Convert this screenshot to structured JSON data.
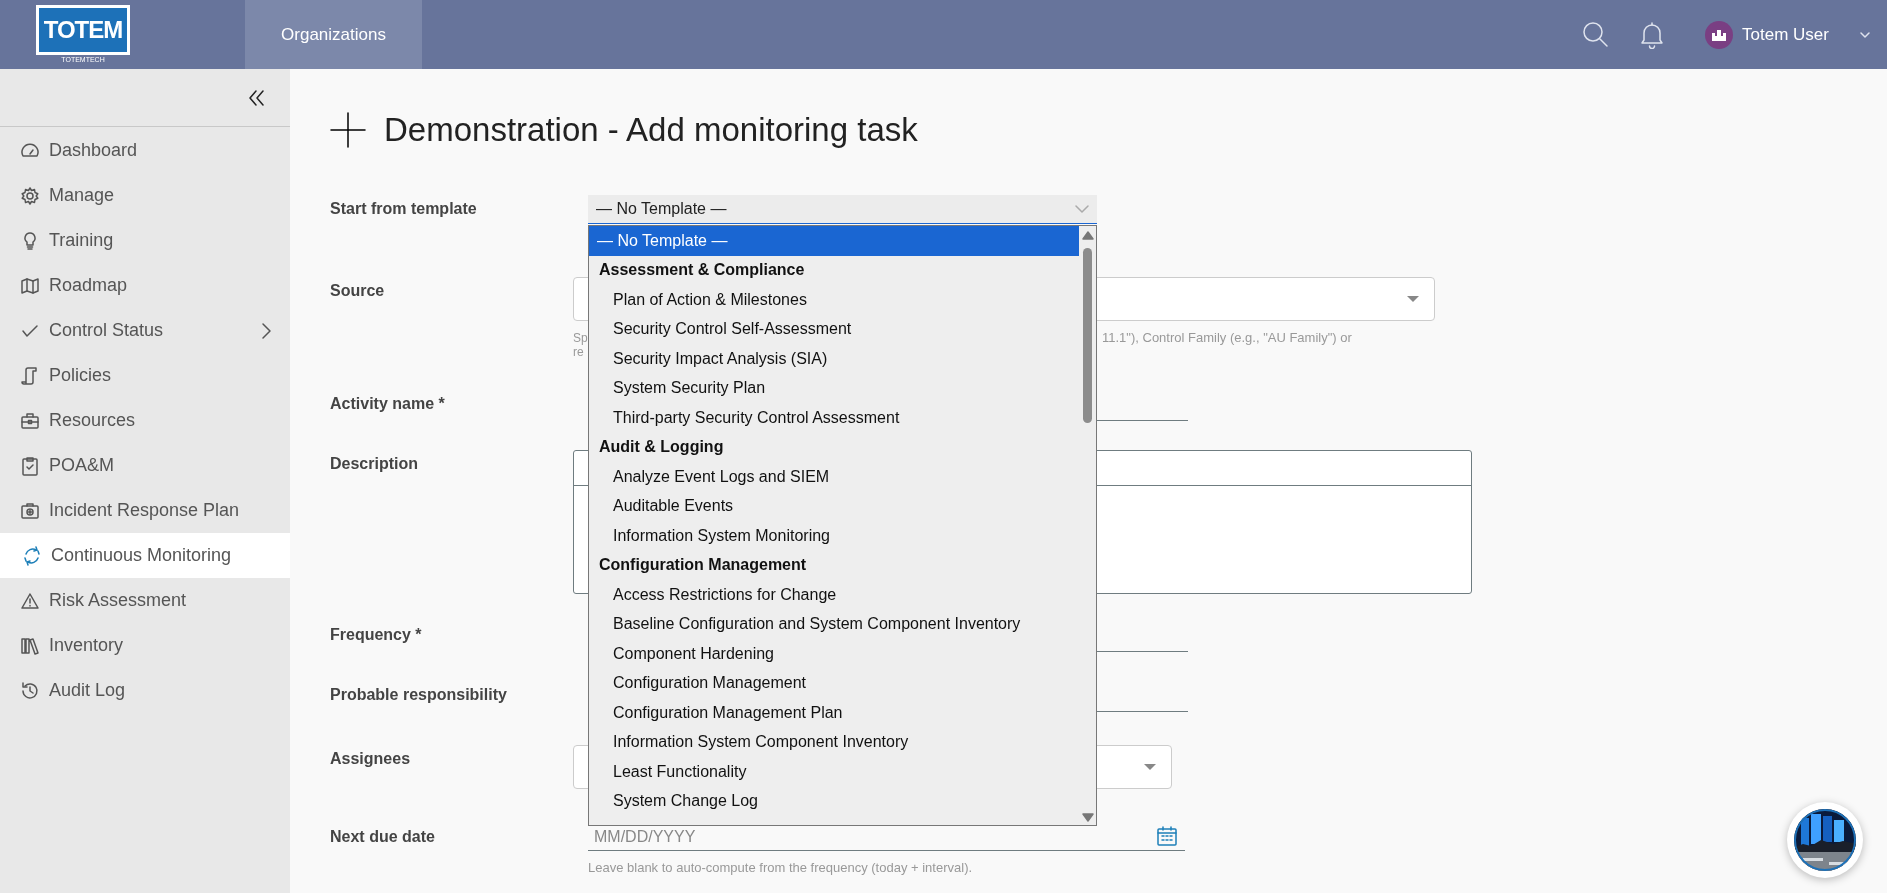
{
  "header": {
    "logo": {
      "text": "TOTEM",
      "subtext": "TOTEMTECH"
    },
    "nav": [
      {
        "label": "Organizations",
        "selected": true
      }
    ],
    "user": {
      "name": "Totem User"
    }
  },
  "sidebar": {
    "items": [
      {
        "label": "Dashboard",
        "selected": false,
        "has_submenu": false
      },
      {
        "label": "Manage",
        "selected": false,
        "has_submenu": false
      },
      {
        "label": "Training",
        "selected": false,
        "has_submenu": false
      },
      {
        "label": "Roadmap",
        "selected": false,
        "has_submenu": false
      },
      {
        "label": "Control Status",
        "selected": false,
        "has_submenu": true
      },
      {
        "label": "Policies",
        "selected": false,
        "has_submenu": false
      },
      {
        "label": "Resources",
        "selected": false,
        "has_submenu": false
      },
      {
        "label": "POA&M",
        "selected": false,
        "has_submenu": false
      },
      {
        "label": "Incident Response Plan",
        "selected": false,
        "has_submenu": false
      },
      {
        "label": "Continuous Monitoring",
        "selected": true,
        "has_submenu": false
      },
      {
        "label": "Risk Assessment",
        "selected": false,
        "has_submenu": false
      },
      {
        "label": "Inventory",
        "selected": false,
        "has_submenu": false
      },
      {
        "label": "Audit Log",
        "selected": false,
        "has_submenu": false
      }
    ]
  },
  "page": {
    "title": "Demonstration - Add monitoring task"
  },
  "form": {
    "fields": [
      {
        "kind": "template",
        "label": "Start from template",
        "value": "— No Template —",
        "expanded": true,
        "options": [
          {
            "kind": "option",
            "label": "— No Template —",
            "selected": true
          },
          {
            "kind": "group",
            "label": "Assessment & Compliance"
          },
          {
            "kind": "option",
            "label": "Plan of Action & Milestones",
            "selected": false
          },
          {
            "kind": "option",
            "label": "Security Control Self-Assessment",
            "selected": false
          },
          {
            "kind": "option",
            "label": "Security Impact Analysis (SIA)",
            "selected": false
          },
          {
            "kind": "option",
            "label": "System Security Plan",
            "selected": false
          },
          {
            "kind": "option",
            "label": "Third-party Security Control Assessment",
            "selected": false
          },
          {
            "kind": "group",
            "label": "Audit & Logging"
          },
          {
            "kind": "option",
            "label": "Analyze Event Logs and SIEM",
            "selected": false
          },
          {
            "kind": "option",
            "label": "Auditable Events",
            "selected": false
          },
          {
            "kind": "option",
            "label": "Information System Monitoring",
            "selected": false
          },
          {
            "kind": "group",
            "label": "Configuration Management"
          },
          {
            "kind": "option",
            "label": "Access Restrictions for Change",
            "selected": false
          },
          {
            "kind": "option",
            "label": "Baseline Configuration and System Component Inventory",
            "selected": false
          },
          {
            "kind": "option",
            "label": "Component Hardening",
            "selected": false
          },
          {
            "kind": "option",
            "label": "Configuration Management",
            "selected": false
          },
          {
            "kind": "option",
            "label": "Configuration Management Plan",
            "selected": false
          },
          {
            "kind": "option",
            "label": "Information System Component Inventory",
            "selected": false
          },
          {
            "kind": "option",
            "label": "Least Functionality",
            "selected": false
          },
          {
            "kind": "option",
            "label": "System Change Log",
            "selected": false
          }
        ]
      },
      {
        "kind": "select",
        "label": "Source",
        "help_left": [
          "Sp",
          "re"
        ],
        "help_right": "11.1\"), Control Family (e.g., \"AU Family\") or"
      },
      {
        "kind": "line",
        "label": "Activity name *"
      },
      {
        "kind": "editor",
        "label": "Description"
      },
      {
        "kind": "line",
        "label": "Frequency *"
      },
      {
        "kind": "line",
        "label": "Probable responsibility"
      },
      {
        "kind": "select",
        "label": "Assignees"
      },
      {
        "kind": "date",
        "label": "Next due date",
        "placeholder": "MM/DD/YYYY",
        "help": "Leave blank to auto-compute from the frequency (today + interval)."
      }
    ]
  }
}
